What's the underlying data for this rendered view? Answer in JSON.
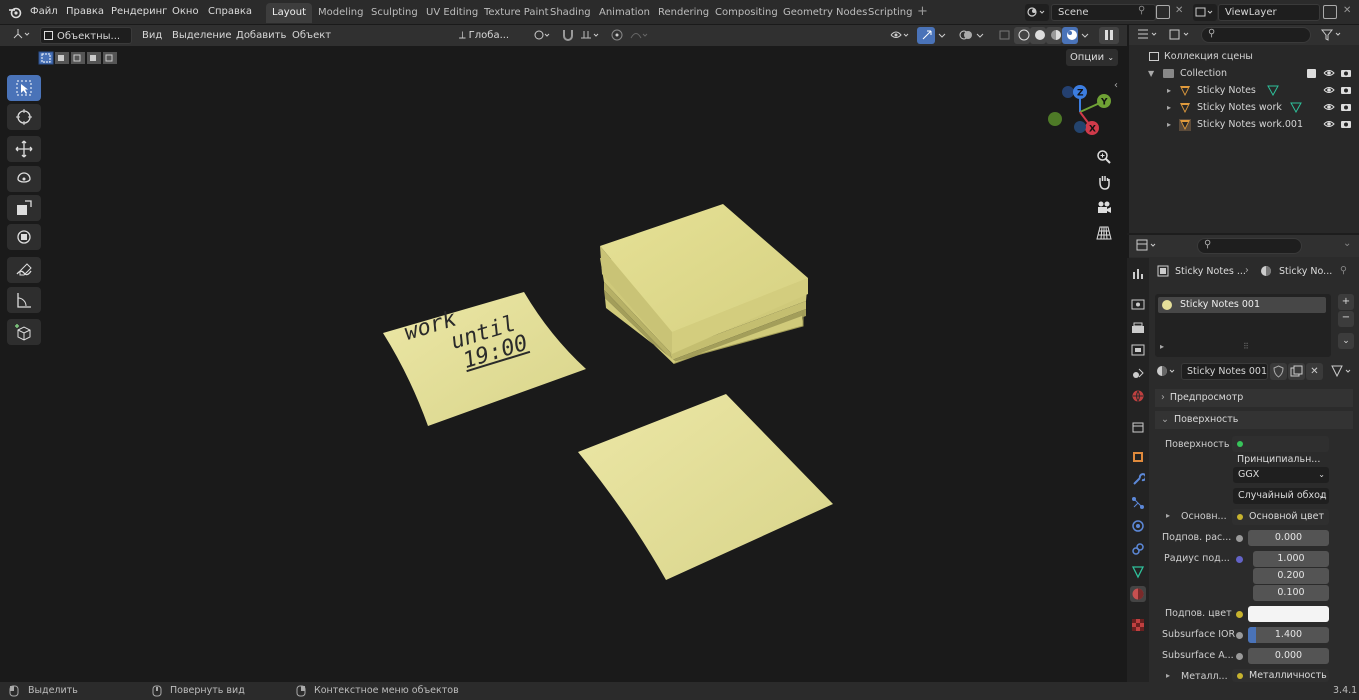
{
  "menus": {
    "file": "Файл",
    "edit": "Правка",
    "render": "Рендеринг",
    "window": "Окно",
    "help": "Справка"
  },
  "workspaces": [
    "Layout",
    "Modeling",
    "Sculpting",
    "UV Editing",
    "Texture Paint",
    "Shading",
    "Animation",
    "Rendering",
    "Compositing",
    "Geometry Nodes",
    "Scripting"
  ],
  "scene": {
    "scene_name": "Scene",
    "view_layer": "ViewLayer"
  },
  "header3d": {
    "mode": "Объектны...",
    "view": "Вид",
    "select": "Выделение",
    "add": "Добавить",
    "object": "Объект",
    "transform": "Глоба...",
    "options": "Опции"
  },
  "viewport": {
    "note_text": [
      "work",
      "until",
      "19:00"
    ]
  },
  "outliner": {
    "scene_collection": "Коллекция сцены",
    "collection": "Collection",
    "items": [
      "Sticky Notes",
      "Sticky Notes work",
      "Sticky Notes work.001"
    ]
  },
  "props": {
    "breadcrumb_obj": "Sticky Notes ...",
    "breadcrumb_mat": "Sticky No...",
    "slot": "Sticky Notes 001",
    "material": "Sticky Notes 001",
    "preview": "Предпросмотр",
    "surface_panel": "Поверхность",
    "surface_label": "Поверхность",
    "surface_value": "Принципиальн...",
    "distribution": "GGX",
    "subsurface_method": "Случайный обход",
    "base_label": "Основн...",
    "base_value": "Основной цвет",
    "ss_label": "Подпов. рас...",
    "ss_value": "0.000",
    "radius_label": "Радиус под...",
    "radius": [
      "1.000",
      "0.200",
      "0.100"
    ],
    "sscolor_label": "Подпов. цвет",
    "ior_label": "Subsurface IOR",
    "ior_value": "1.400",
    "aniso_label": "Subsurface A...",
    "aniso_value": "0.000",
    "metal_label": "Металл...",
    "metal_value": "Металличность"
  },
  "status": {
    "select": "Выделить",
    "rotate": "Повернуть вид",
    "context": "Контекстное меню объектов",
    "version": "3.4.1"
  },
  "colors": {
    "accent": "#4a73b8",
    "note": "#e0dc96",
    "viewport_bg": "#1a1a1a"
  }
}
